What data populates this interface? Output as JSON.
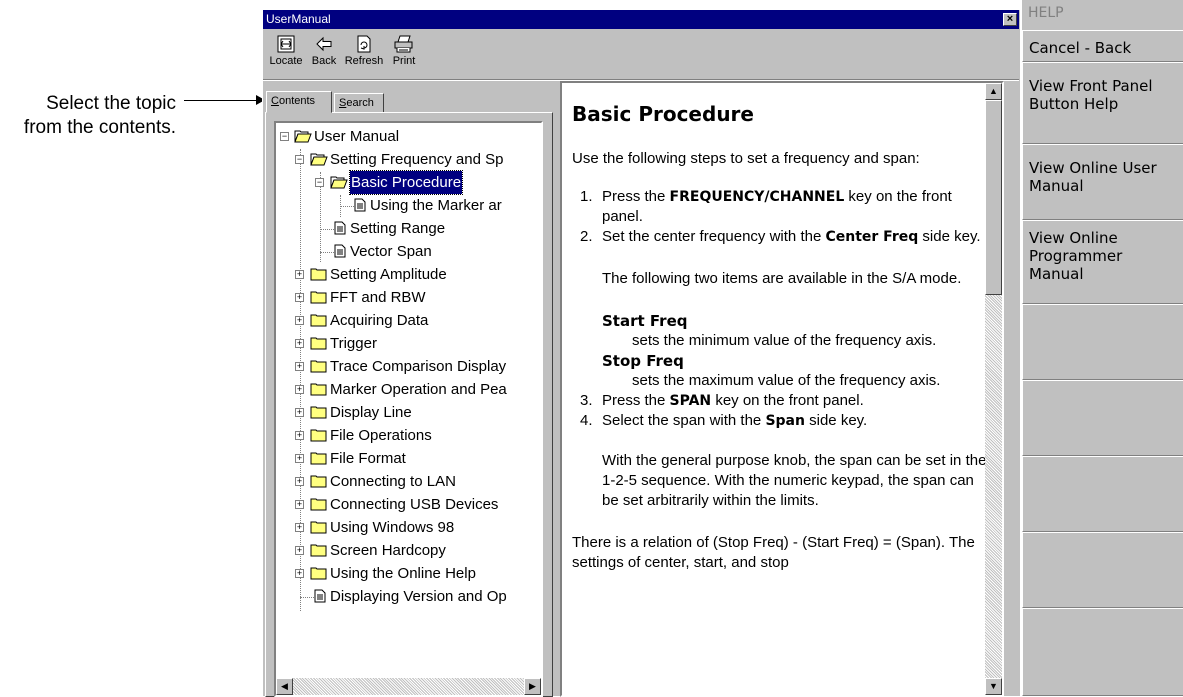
{
  "annotation": {
    "line1": "Select the topic",
    "line2": "from the contents."
  },
  "window": {
    "title": "UserManual",
    "close_label": "×"
  },
  "toolbar": {
    "locate": "Locate",
    "back": "Back",
    "refresh": "Refresh",
    "print": "Print"
  },
  "tabs": {
    "contents_first": "C",
    "contents_rest": "ontents",
    "search_first": "S",
    "search_rest": "earch"
  },
  "tree": {
    "root": "User Manual",
    "items": [
      "Setting Frequency and Sp",
      "Basic Procedure",
      "Using the Marker ar",
      "Setting Range",
      "Vector Span",
      "Setting Amplitude",
      "FFT and RBW",
      "Acquiring Data",
      "Trigger",
      "Trace Comparison Display",
      "Marker Operation and Pea",
      "Display Line",
      "File Operations",
      "File Format",
      "Connecting to LAN",
      "Connecting USB Devices",
      "Using Windows 98",
      "Screen Hardcopy",
      "Using the Online Help",
      "Displaying Version and Op"
    ]
  },
  "content": {
    "heading": "Basic Procedure",
    "intro": "Use the following steps to set a frequency and span:",
    "step1_num": "1.",
    "step1_a": "Press the ",
    "step1_b": "FREQUENCY/CHANNEL",
    "step1_c": " key on the front panel.",
    "step2_num": "2.",
    "step2_a": "Set the center frequency with the ",
    "step2_b": "Center Freq",
    "step2_c": " side key.",
    "step2_note": "The following two items are available in the S/A mode.",
    "start_term": "Start Freq",
    "start_def": "sets the minimum value of the frequency axis.",
    "stop_term": "Stop Freq",
    "stop_def": "sets the maximum value of the frequency axis.",
    "step3_num": "3.",
    "step3_a": "Press the ",
    "step3_b": "SPAN",
    "step3_c": " key on the front panel.",
    "step4_num": "4.",
    "step4_a": "Select the span with the ",
    "step4_b": "Span",
    "step4_c": " side key.",
    "step4_note": "With the general purpose knob, the span can be set in the 1-2-5 sequence. With the numeric keypad, the span can be set arbitrarily within the limits.",
    "relation": "There is a relation of (Stop Freq) - (Start Freq) = (Span). The settings of center, start, and stop"
  },
  "sidemenu": {
    "header": "HELP",
    "cancel": "Cancel - Back",
    "front_panel": "View Front Panel Button Help",
    "online_user": "View Online User Manual",
    "online_prog": "View Online Programmer Manual"
  }
}
